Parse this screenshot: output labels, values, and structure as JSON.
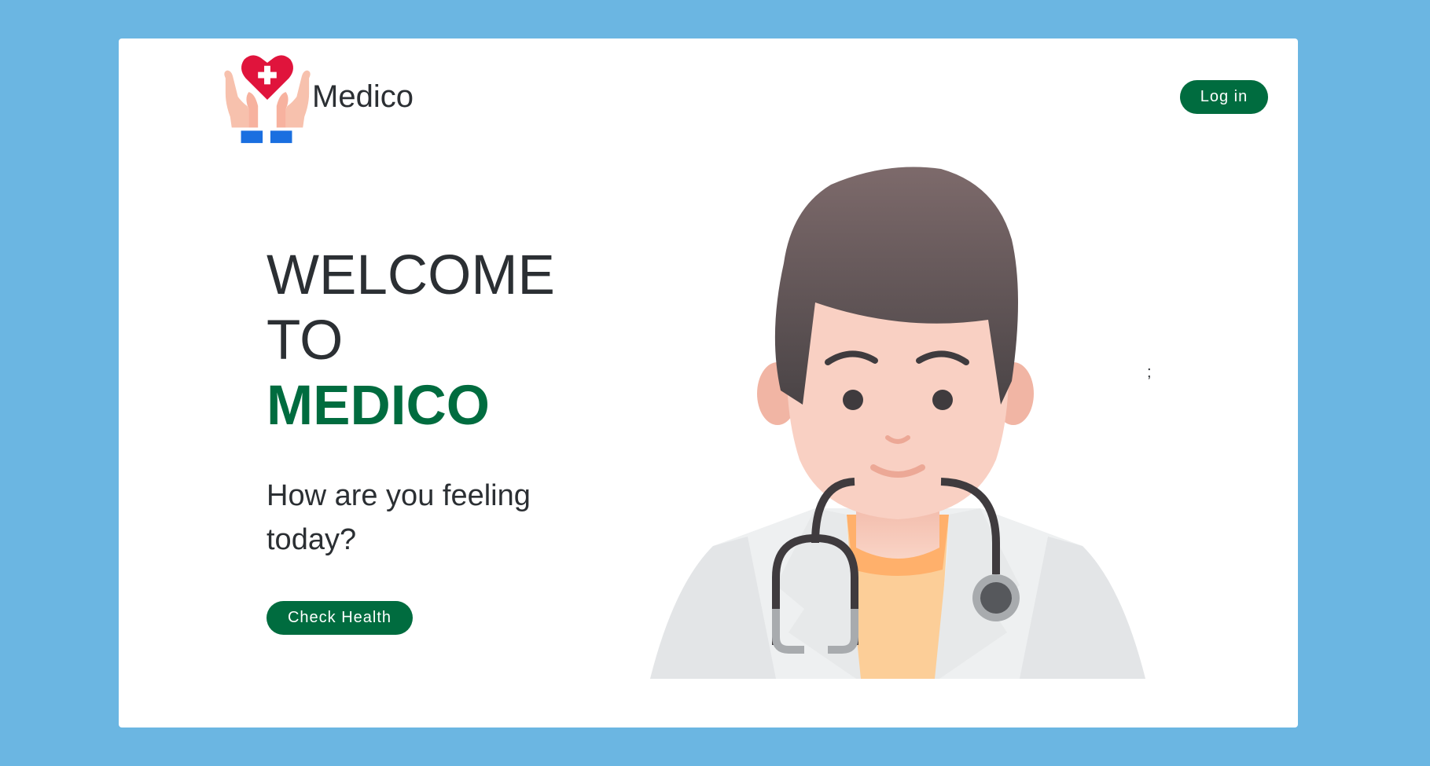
{
  "header": {
    "brand_name": "Medico",
    "login_label": "Log in",
    "logo_icon": "hands-heart-cross-icon"
  },
  "hero": {
    "line1": "WELCOME",
    "line2": "TO",
    "line3": "MEDICO",
    "subtitle": "How are you feeling today?",
    "cta_label": "Check Health",
    "illustration_icon": "doctor-illustration"
  },
  "stray_text": ";",
  "colors": {
    "page_background": "#6bb6e2",
    "card_background": "#ffffff",
    "brand_green": "#006c3f",
    "text_dark": "#2b2f33",
    "heart_red": "#e0143c"
  }
}
